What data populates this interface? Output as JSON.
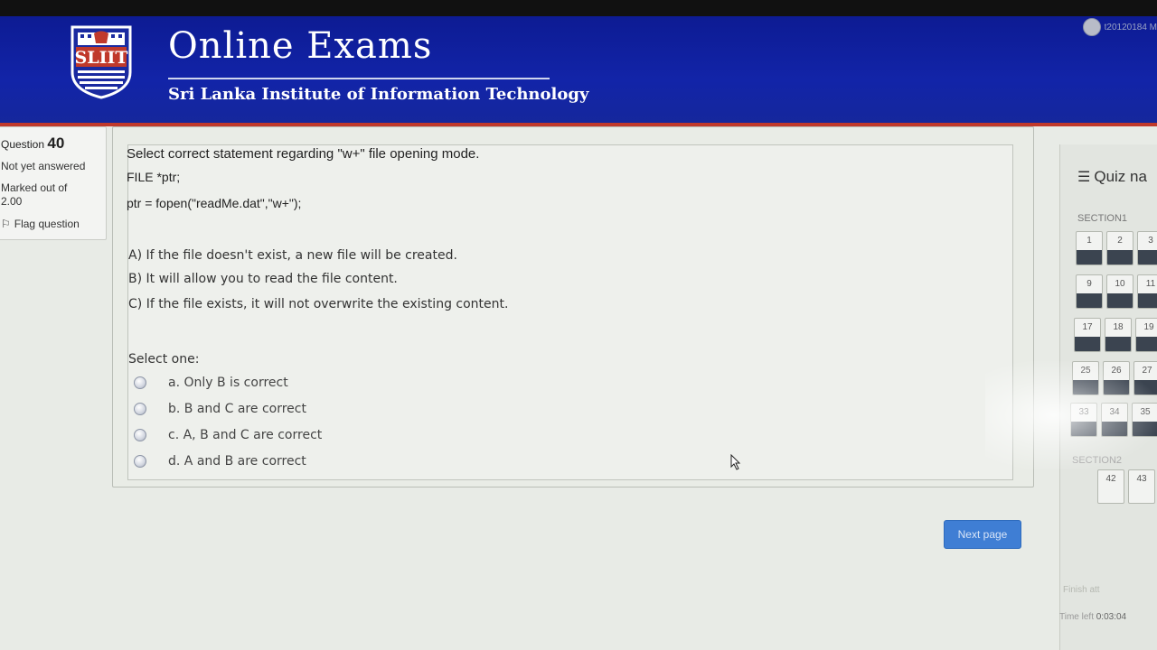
{
  "header": {
    "logo_text": "SLIIT",
    "title": "Online Exams",
    "subtitle": "Sri Lanka Institute of Information Technology",
    "user_name": "t20120184 M"
  },
  "question_info": {
    "label": "Question",
    "number": "40",
    "state": "Not yet answered",
    "grade": "Marked out of 2.00",
    "flag_label": "Flag question"
  },
  "question": {
    "line1": "Select correct statement regarding \"w+\" file opening mode.",
    "line2": "FILE *ptr;",
    "line3": "ptr = fopen(\"readMe.dat\",\"w+\");",
    "statements": [
      "A) If the file doesn't exist, a new file will be created.",
      "B) It will allow you to read the file content.",
      "C) If the file exists, it will not overwrite the existing content."
    ],
    "prompt": "Select one:",
    "answers": [
      "a. Only B is correct",
      "b. B and C are correct",
      "c. A, B and C are correct",
      "d. A and B are correct"
    ]
  },
  "next_button": "Next page",
  "quiz_nav": {
    "title": "Quiz na",
    "section1": "SECTION1",
    "section2": "SECTION2",
    "rows": [
      [
        "1",
        "2",
        "3"
      ],
      [
        "9",
        "10",
        "11"
      ],
      [
        "17",
        "18",
        "19"
      ],
      [
        "25",
        "26",
        "27"
      ],
      [
        "33",
        "34",
        "35"
      ]
    ],
    "section2_buttons": [
      "42",
      "43"
    ],
    "finish_link": "Finish att",
    "time_label": "Time left",
    "time_value": "0:03:04"
  },
  "colors": {
    "header_blue": "#1224a8",
    "header_border": "#c0392b",
    "next_button": "#3f7ed4",
    "answered_fill": "#3b4450"
  }
}
